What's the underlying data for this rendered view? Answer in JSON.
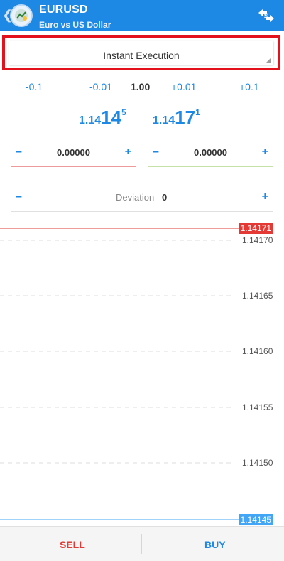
{
  "header": {
    "symbol": "EURUSD",
    "description": "Euro vs US Dollar",
    "back_icon": "chevron-left-icon",
    "logo_icon": "metatrader-logo-icon",
    "swap_icon": "currency-exchange-icon",
    "color": "#1e88e5"
  },
  "order_type": {
    "label": "Instant Execution",
    "highlight_color": "#e3111b"
  },
  "volume": {
    "minus_big": "-0.1",
    "minus_small": "-0.01",
    "value": "1.00",
    "plus_small": "+0.01",
    "plus_big": "+0.1"
  },
  "prices": {
    "bid": {
      "prefix": "1.14",
      "big": "14",
      "sup": "5"
    },
    "ask": {
      "prefix": "1.14",
      "big": "17",
      "sup": "1"
    }
  },
  "stop_loss": {
    "minus": "–",
    "value": "0.00000",
    "plus": "+",
    "color": "#ef9a9a"
  },
  "take_profit": {
    "minus": "–",
    "value": "0.00000",
    "plus": "+",
    "color": "#c5e1a5"
  },
  "deviation": {
    "minus": "–",
    "label": "Deviation",
    "value": "0",
    "plus": "+"
  },
  "chart_labels": {
    "ask_tag": "1.14171",
    "bid_tag": "1.14145",
    "levels": [
      "1.14170",
      "1.14165",
      "1.14160",
      "1.14155",
      "1.14150"
    ],
    "ask_color": "#e53935",
    "bid_color": "#42a5f5"
  },
  "actions": {
    "sell": "SELL",
    "buy": "BUY",
    "sell_color": "#e53935",
    "buy_color": "#1e88e5"
  }
}
